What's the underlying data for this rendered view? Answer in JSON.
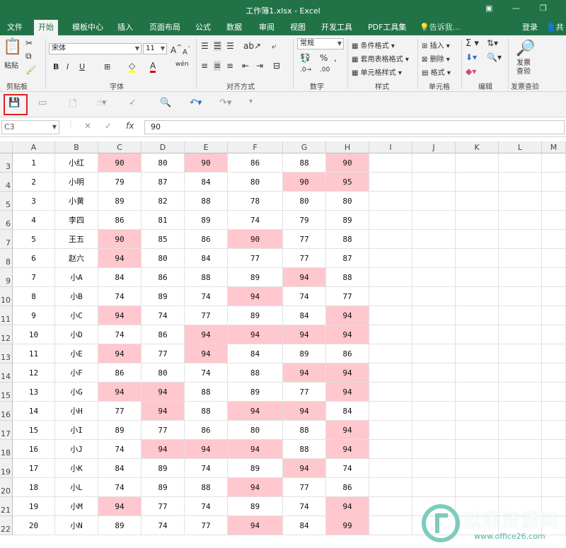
{
  "app": {
    "window_title": "工作簿1.xlsx - Excel"
  },
  "menu": {
    "tabs": [
      "文件",
      "开始",
      "模板中心",
      "插入",
      "页面布局",
      "公式",
      "数据",
      "审阅",
      "视图",
      "开发工具",
      "PDF工具集"
    ],
    "active_tab": "开始",
    "tell_me": "告诉我...",
    "login": "登录",
    "share": "共"
  },
  "ribbon": {
    "clipboard": {
      "label": "剪贴板",
      "paste": "粘贴"
    },
    "font": {
      "label": "字体",
      "name": "宋体",
      "size": "11",
      "bold": "B",
      "italic": "I",
      "underline": "U",
      "grow": "A",
      "shrink": "A",
      "phonetic": "wén"
    },
    "alignment": {
      "label": "对齐方式"
    },
    "number": {
      "label": "数字",
      "format": "常规"
    },
    "styles": {
      "label": "样式",
      "cond_format": "条件格式",
      "table_format": "套用表格格式",
      "cell_styles": "单元格样式"
    },
    "cells": {
      "label": "单元格",
      "insert": "插入",
      "delete": "删除",
      "format": "格式"
    },
    "editing": {
      "label": "编辑"
    },
    "invoice": {
      "label": "发票查验",
      "button_line1": "发票",
      "button_line2": "查验"
    }
  },
  "formula_bar": {
    "name_box": "C3",
    "formula": "90",
    "fx": "fx"
  },
  "sheet": {
    "columns": [
      "A",
      "B",
      "C",
      "D",
      "E",
      "F",
      "G",
      "H",
      "I",
      "J",
      "K",
      "L",
      "M"
    ],
    "rows": [
      {
        "n": "3",
        "cells": [
          "1",
          "小红",
          "90",
          "80",
          "90",
          "86",
          "88",
          "90"
        ],
        "hl": [
          2,
          4,
          7
        ]
      },
      {
        "n": "4",
        "cells": [
          "2",
          "小明",
          "79",
          "87",
          "84",
          "80",
          "90",
          "95"
        ],
        "hl": [
          6,
          7
        ]
      },
      {
        "n": "5",
        "cells": [
          "3",
          "小黄",
          "89",
          "82",
          "88",
          "78",
          "80",
          "80"
        ],
        "hl": []
      },
      {
        "n": "6",
        "cells": [
          "4",
          "李四",
          "86",
          "81",
          "89",
          "74",
          "79",
          "89"
        ],
        "hl": []
      },
      {
        "n": "7",
        "cells": [
          "5",
          "王五",
          "90",
          "85",
          "86",
          "90",
          "77",
          "88"
        ],
        "hl": [
          2,
          5
        ]
      },
      {
        "n": "8",
        "cells": [
          "6",
          "赵六",
          "94",
          "80",
          "84",
          "77",
          "77",
          "87"
        ],
        "hl": [
          2
        ]
      },
      {
        "n": "9",
        "cells": [
          "7",
          "小A",
          "84",
          "86",
          "88",
          "89",
          "94",
          "88"
        ],
        "hl": [
          6
        ]
      },
      {
        "n": "10",
        "cells": [
          "8",
          "小B",
          "74",
          "89",
          "74",
          "94",
          "74",
          "77"
        ],
        "hl": [
          5
        ]
      },
      {
        "n": "11",
        "cells": [
          "9",
          "小C",
          "94",
          "74",
          "77",
          "89",
          "84",
          "94"
        ],
        "hl": [
          2,
          7
        ]
      },
      {
        "n": "12",
        "cells": [
          "10",
          "小D",
          "74",
          "86",
          "94",
          "94",
          "94",
          "94"
        ],
        "hl": [
          4,
          5,
          6,
          7
        ]
      },
      {
        "n": "13",
        "cells": [
          "11",
          "小E",
          "94",
          "77",
          "94",
          "84",
          "89",
          "86"
        ],
        "hl": [
          2,
          4
        ]
      },
      {
        "n": "14",
        "cells": [
          "12",
          "小F",
          "86",
          "80",
          "74",
          "88",
          "94",
          "94"
        ],
        "hl": [
          6,
          7
        ]
      },
      {
        "n": "15",
        "cells": [
          "13",
          "小G",
          "94",
          "94",
          "88",
          "89",
          "77",
          "94"
        ],
        "hl": [
          2,
          3,
          7
        ]
      },
      {
        "n": "16",
        "cells": [
          "14",
          "小H",
          "77",
          "94",
          "88",
          "94",
          "94",
          "84"
        ],
        "hl": [
          3,
          5,
          6
        ]
      },
      {
        "n": "17",
        "cells": [
          "15",
          "小I",
          "89",
          "77",
          "86",
          "80",
          "88",
          "94"
        ],
        "hl": [
          7
        ]
      },
      {
        "n": "18",
        "cells": [
          "16",
          "小J",
          "74",
          "94",
          "94",
          "94",
          "88",
          "94"
        ],
        "hl": [
          3,
          4,
          5,
          7
        ]
      },
      {
        "n": "19",
        "cells": [
          "17",
          "小K",
          "84",
          "89",
          "74",
          "89",
          "94",
          "74"
        ],
        "hl": [
          6
        ]
      },
      {
        "n": "20",
        "cells": [
          "18",
          "小L",
          "74",
          "89",
          "88",
          "94",
          "77",
          "86"
        ],
        "hl": [
          5
        ]
      },
      {
        "n": "21",
        "cells": [
          "19",
          "小M",
          "94",
          "77",
          "74",
          "89",
          "74",
          "94"
        ],
        "hl": [
          2,
          7
        ]
      },
      {
        "n": "22",
        "cells": [
          "20",
          "小N",
          "89",
          "74",
          "77",
          "94",
          "84",
          "99"
        ],
        "hl": [
          5,
          7
        ]
      }
    ]
  },
  "watermark": {
    "text": "欧菲资源网",
    "url": "www.office26.com"
  },
  "colors": {
    "accent": "#217346",
    "highlight": "#ffc7ce",
    "save_box": "#e02020"
  }
}
